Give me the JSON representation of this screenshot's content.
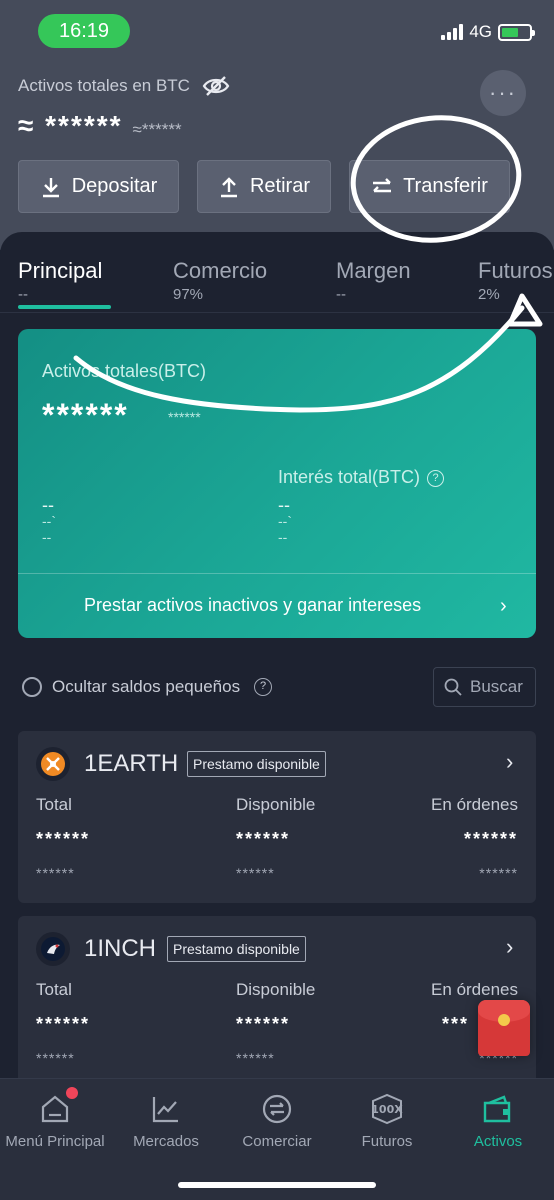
{
  "status": {
    "time": "16:19",
    "network": "4G"
  },
  "header": {
    "totals_label": "Activos totales en BTC",
    "balance_main": "≈ ******",
    "balance_sub": "≈******",
    "more_label": "···"
  },
  "actions": {
    "deposit": "Depositar",
    "withdraw": "Retirar",
    "transfer": "Transferir"
  },
  "tabs": [
    {
      "label": "Principal",
      "sub": "--"
    },
    {
      "label": "Comercio",
      "sub": "97%"
    },
    {
      "label": "Margen",
      "sub": "--"
    },
    {
      "label": "Futuros",
      "sub": "2%"
    }
  ],
  "card": {
    "total_label": "Activos totales(BTC)",
    "total_value": "******",
    "total_sub": "******",
    "interest_label": "Interés total(BTC)",
    "left_value": "--",
    "left_mid": "--`",
    "left_sub": "--",
    "right_value": "--",
    "right_mid": "--`",
    "right_sub": "--",
    "cta": "Prestar activos inactivos y ganar intereses"
  },
  "filters": {
    "hide_small": "Ocultar saldos pequeños",
    "search_placeholder": "Buscar"
  },
  "columns": {
    "total": "Total",
    "available": "Disponible",
    "in_orders": "En órdenes"
  },
  "assets": [
    {
      "name": "1EARTH",
      "badge": "Prestamo disponible",
      "total": "******",
      "available": "******",
      "orders": "******",
      "total_sub": "******",
      "available_sub": "******",
      "orders_sub": "******"
    },
    {
      "name": "1INCH",
      "badge": "Prestamo disponible",
      "total": "******",
      "available": "******",
      "orders": "***",
      "total_sub": "******",
      "available_sub": "******",
      "orders_sub": "******"
    }
  ],
  "nav": [
    {
      "label": "Menú Principal"
    },
    {
      "label": "Mercados"
    },
    {
      "label": "Comerciar"
    },
    {
      "label": "Futuros"
    },
    {
      "label": "Activos"
    }
  ],
  "colors": {
    "accent": "#1fbf9f",
    "card": "#1ba796",
    "background": "#1d2230"
  }
}
